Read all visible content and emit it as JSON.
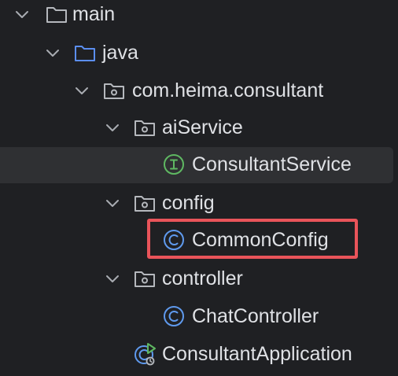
{
  "project_tree": {
    "items": [
      {
        "label": "main",
        "icon": "folder-icon",
        "expanded": true
      },
      {
        "label": "java",
        "icon": "source-folder-icon",
        "expanded": true
      },
      {
        "label": "com.heima.consultant",
        "icon": "package-icon",
        "expanded": true
      },
      {
        "label": "aiService",
        "icon": "package-icon",
        "expanded": true
      },
      {
        "label": "ConsultantService",
        "icon": "interface-icon",
        "selected": true
      },
      {
        "label": "config",
        "icon": "package-icon",
        "expanded": true
      },
      {
        "label": "CommonConfig",
        "icon": "class-icon",
        "highlighted": true
      },
      {
        "label": "controller",
        "icon": "package-icon",
        "expanded": true
      },
      {
        "label": "ChatController",
        "icon": "class-icon"
      },
      {
        "label": "ConsultantApplication",
        "icon": "spring-boot-app-icon"
      }
    ]
  },
  "colors": {
    "background": "#1f2023",
    "selection": "#2f3033",
    "highlight_border": "#e9545a",
    "java_folder": "#5b8ef0",
    "class_icon": "#5f9aee",
    "interface_icon": "#5fb862"
  }
}
